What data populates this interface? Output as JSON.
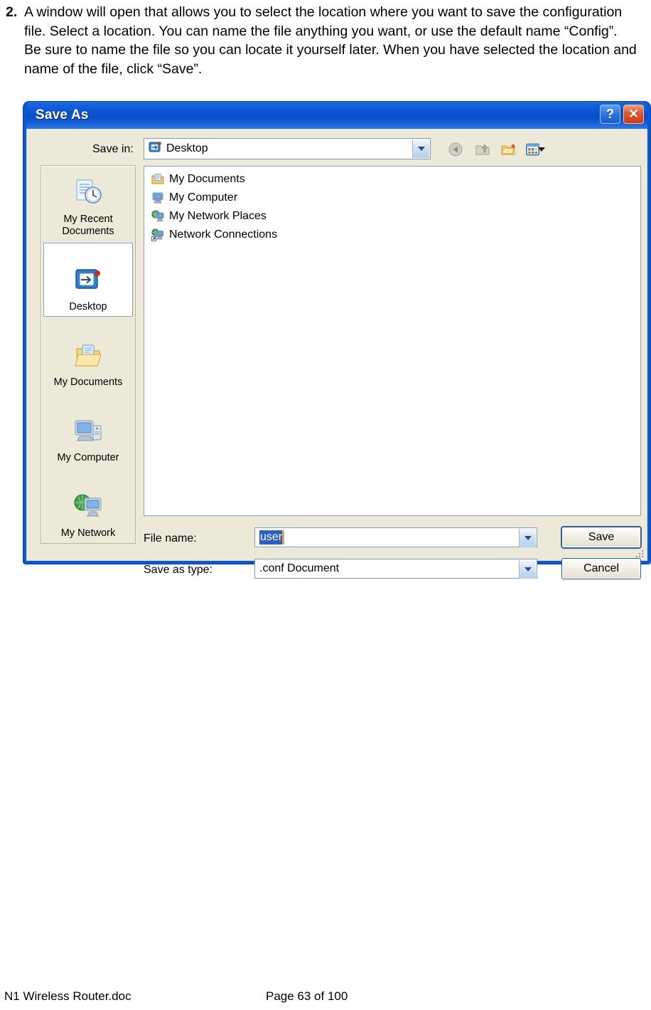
{
  "instruction": {
    "number": "2.",
    "text": "A window will open that allows you to select the location where you want to save the configuration file. Select a location. You can name the file anything you want, or use the default name “Config”. Be sure to name the file so you can locate it yourself later. When you have selected the location and name of the file, click “Save”."
  },
  "dialog": {
    "title": "Save As",
    "titlebar_buttons": [
      {
        "name": "help-button",
        "glyph": "?"
      },
      {
        "name": "close-button",
        "glyph": "✕"
      }
    ],
    "savein": {
      "label": "Save in:",
      "value": "Desktop",
      "icon": "desktop-icon",
      "dropdown_icon": "chevron-down-icon"
    },
    "toolbar_icons": [
      {
        "name": "back-icon",
        "label": "Back"
      },
      {
        "name": "up-one-level-icon",
        "label": "Up One Level"
      },
      {
        "name": "create-new-folder-icon",
        "label": "Create New Folder"
      },
      {
        "name": "views-icon",
        "label": "Views"
      }
    ],
    "places": [
      {
        "label": "My Recent Documents",
        "icon": "recent-documents-icon",
        "selected": false
      },
      {
        "label": "Desktop",
        "icon": "desktop-icon",
        "selected": true
      },
      {
        "label": "My Documents",
        "icon": "my-documents-icon",
        "selected": false
      },
      {
        "label": "My Computer",
        "icon": "my-computer-icon",
        "selected": false
      },
      {
        "label": "My Network",
        "icon": "my-network-icon",
        "selected": false
      }
    ],
    "files": [
      {
        "name": "My Documents",
        "icon": "my-documents-icon"
      },
      {
        "name": "My Computer",
        "icon": "my-computer-icon"
      },
      {
        "name": "My Network Places",
        "icon": "my-network-places-icon"
      },
      {
        "name": "Network Connections",
        "icon": "network-connections-shortcut-icon"
      }
    ],
    "file_name": {
      "label": "File name:",
      "value": "user",
      "selected": true
    },
    "save_as_type": {
      "label": "Save as type:",
      "value": ".conf Document"
    },
    "buttons": {
      "save": "Save",
      "cancel": "Cancel"
    }
  },
  "footer": {
    "document": "N1 Wireless Router.doc",
    "page": "Page 63 of 100"
  },
  "colors": {
    "title_blue": "#0a53d2",
    "frame_blue": "#0a58d6",
    "dialog_face": "#ece9d8",
    "selection_blue": "#2b5fc9",
    "close_red": "#e4542a"
  }
}
